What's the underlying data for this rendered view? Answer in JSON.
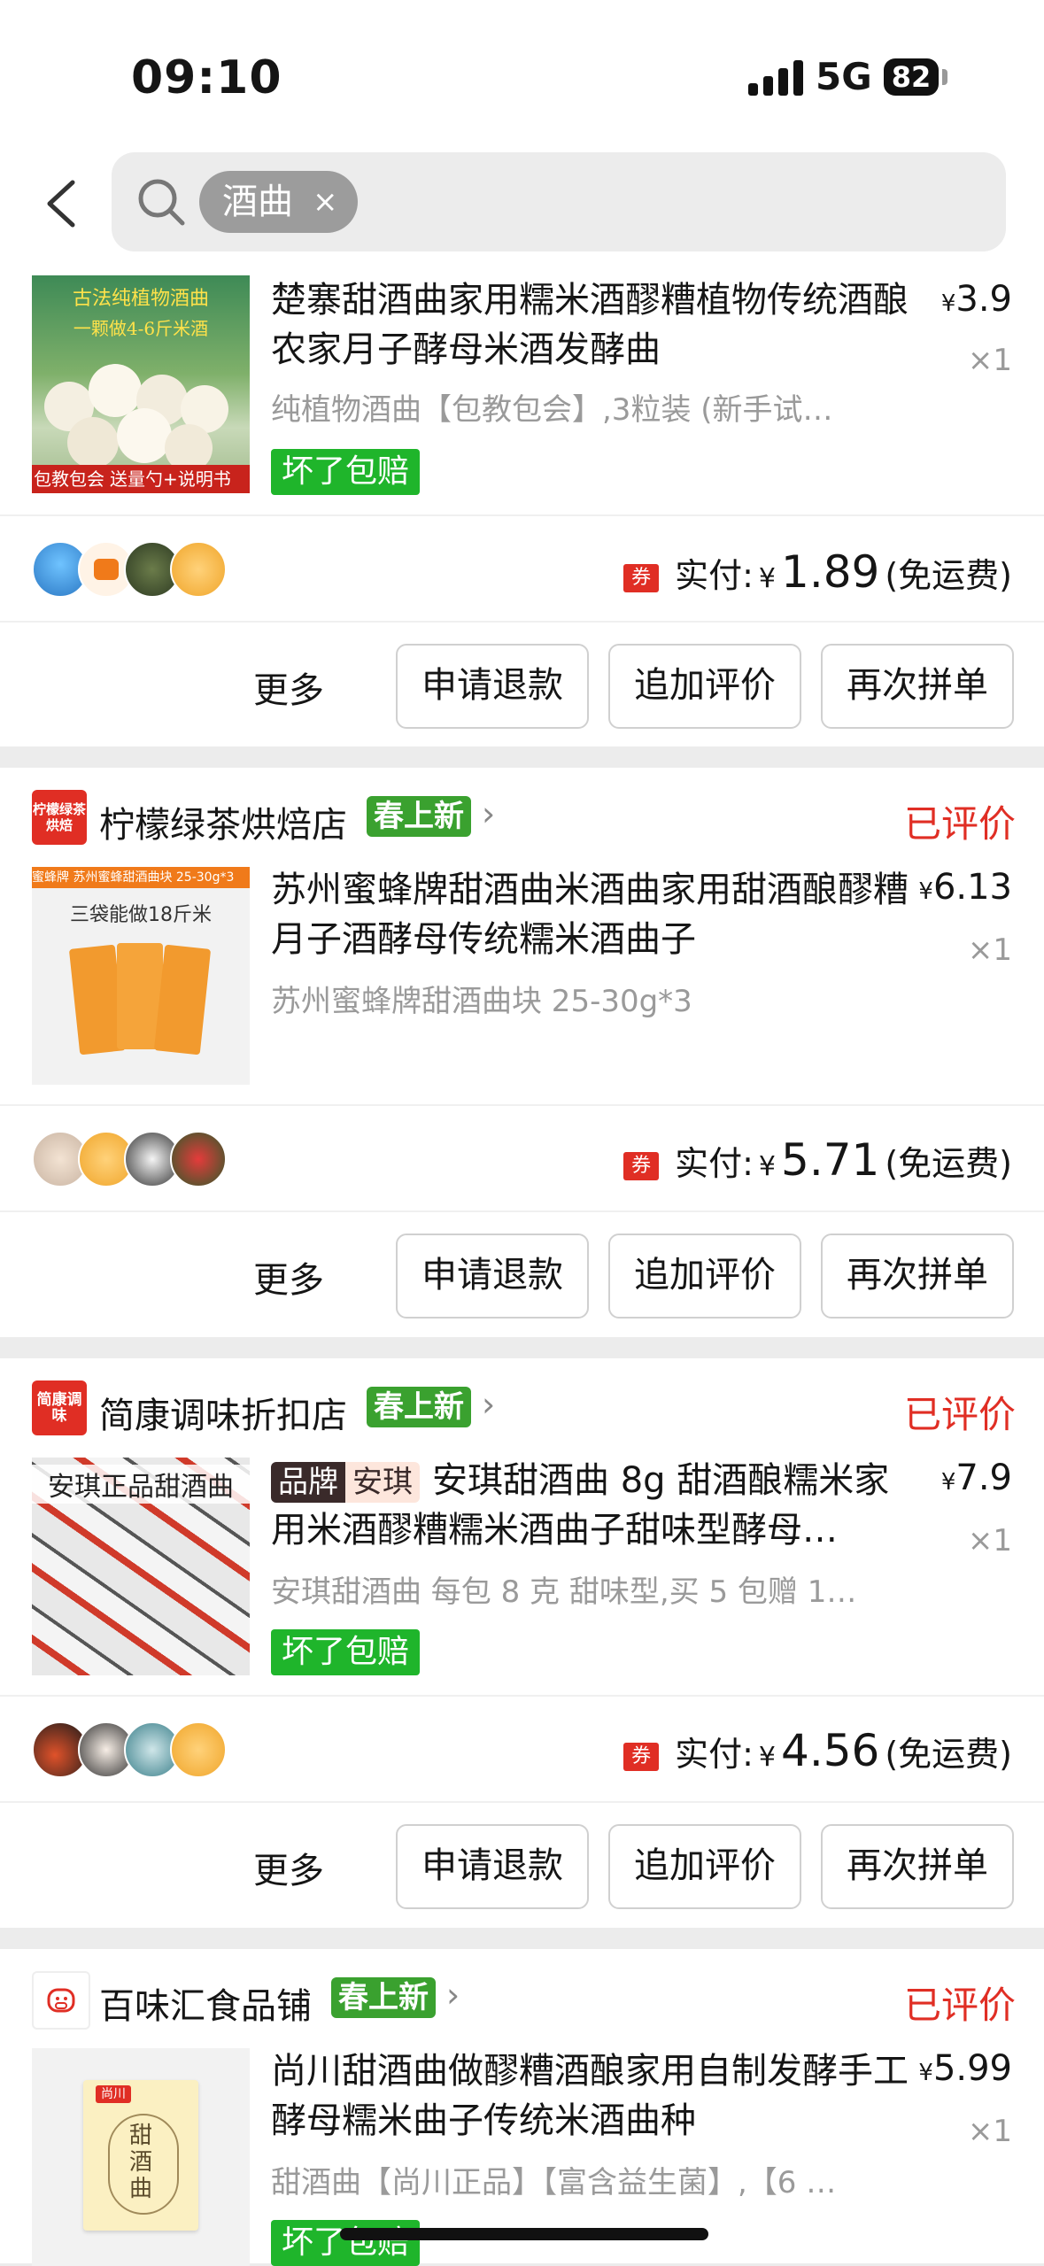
{
  "status_bar": {
    "time": "09:10",
    "network": "5G",
    "battery": "82"
  },
  "search": {
    "chip": "酒曲",
    "chip_close": "×"
  },
  "actions": {
    "more": "更多",
    "refund": "申请退款",
    "review": "追加评价",
    "reorder": "再次拼单"
  },
  "labels": {
    "paid": "实付:",
    "currency": "¥",
    "free_shipping": "(免运费)",
    "coupon": "券",
    "reviewed": "已评价",
    "spring_new": "春上新",
    "guarantee": "坏了包赔"
  },
  "orders": [
    {
      "title": "楚寨甜酒曲家用糯米酒醪糟植物传统酒酿农家月子酵母米酒发酵曲",
      "spec": "纯植物酒曲【包教包会】,3粒装 (新手试…",
      "price": "3.9",
      "qty": "×1",
      "paid": "1.89",
      "thumb_top": "古法纯植物酒曲",
      "thumb_mid": "一颗做4-6斤米酒",
      "thumb_bottom_a": "包教包会",
      "thumb_bottom_b": "送量勺+说明书"
    },
    {
      "shop": "柠檬绿茶烘焙店",
      "shop_logo": "柠檬绿茶烘焙",
      "status": "已评价",
      "title": "苏州蜜蜂牌甜酒曲米酒曲家用甜酒酿醪糟月子酒酵母传统糯米酒曲子",
      "spec": "苏州蜜蜂牌甜酒曲块 25-30g*3",
      "price": "6.13",
      "qty": "×1",
      "paid": "5.71",
      "thumb_top": "蜜蜂牌 苏州蜜蜂甜酒曲块 25-30g*3",
      "thumb_mid": "三袋能做18斤米"
    },
    {
      "shop": "简康调味折扣店",
      "shop_logo": "简康调味",
      "status": "已评价",
      "brand_a": "品牌",
      "brand_b": "安琪",
      "title": "安琪甜酒曲 8g 甜酒酿糯米家用米酒醪糟糯米酒曲子甜味型酵母…",
      "spec": "安琪甜酒曲 每包 8 克 甜味型,买 5 包赠 1…",
      "price": "7.9",
      "qty": "×1",
      "paid": "4.56",
      "thumb_top": "安琪正品甜酒曲"
    },
    {
      "shop": "百味汇食品铺",
      "status": "已评价",
      "title": "尚川甜酒曲做醪糟酒酿家用自制发酵手工酵母糯米曲子传统米酒曲种",
      "spec": "甜酒曲【尚川正品】【富含益生菌】,【6 …",
      "price": "5.99",
      "qty": "×1",
      "thumb_brand": "尚川",
      "thumb_text": "甜酒曲"
    }
  ],
  "colors": {
    "accent_red": "#e02e24",
    "green": "#1fb52b",
    "spring_green": "#3aa12f"
  }
}
